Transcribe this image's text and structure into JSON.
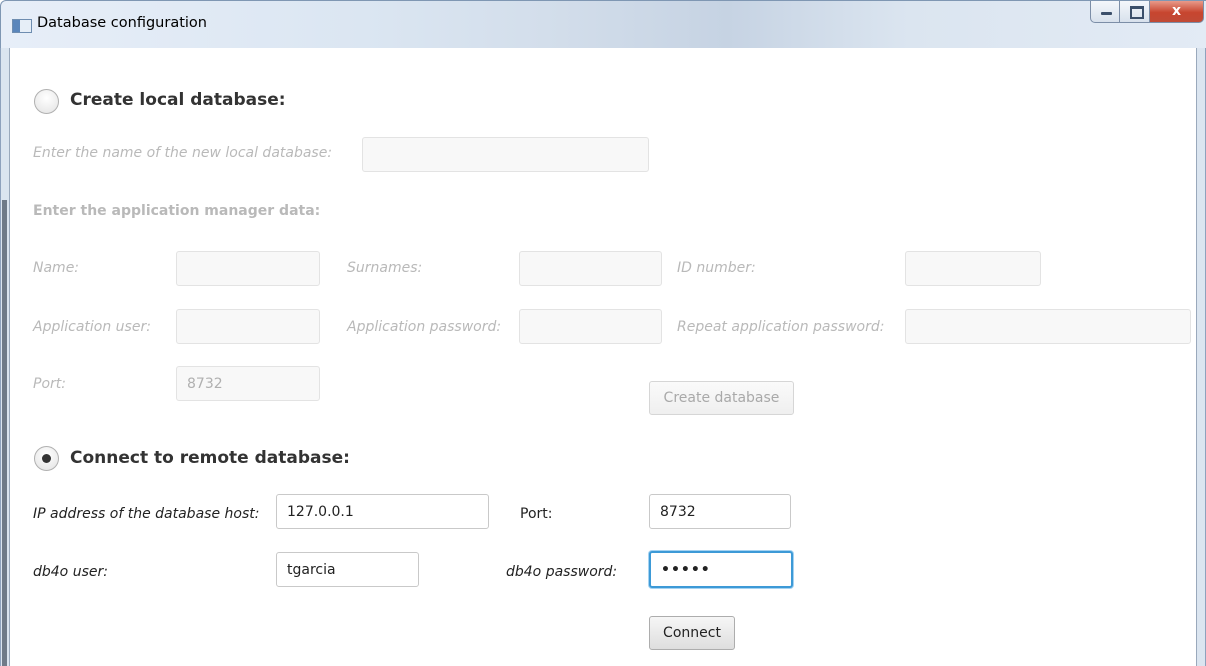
{
  "window": {
    "title": "Database configuration",
    "close_glyph": "x"
  },
  "local": {
    "header": "Create local database:",
    "name_label": "Enter the name of the new local database:",
    "name_value": "",
    "manager_header": "Enter the application manager data:",
    "name_field_label": "Name:",
    "surnames_label": "Surnames:",
    "id_label": "ID number:",
    "app_user_label": "Application user:",
    "app_password_label": "Application password:",
    "repeat_password_label": "Repeat application password:",
    "port_label": "Port:",
    "port_value": "8732",
    "create_button": "Create database",
    "selected": false
  },
  "remote": {
    "header": "Connect to remote database:",
    "host_label": "IP address of the database host:",
    "host_value": "127.0.0.1",
    "port_label": "Port:",
    "port_value": "8732",
    "user_label": "db4o user:",
    "user_value": "tgarcia",
    "password_label": "db4o password:",
    "password_value": "•••••",
    "connect_button": "Connect",
    "selected": true
  }
}
